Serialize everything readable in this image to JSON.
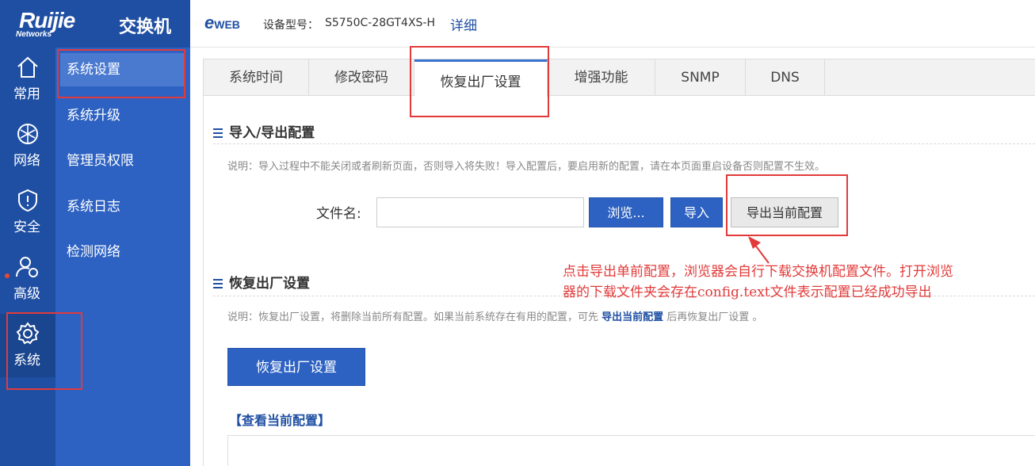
{
  "brand": {
    "logo": "Ruijie",
    "logo_sub": "Networks",
    "product": "交换机"
  },
  "topbar": {
    "eweb": "e",
    "eweb_rest": "WEB",
    "model_label": "设备型号：",
    "model": "S5750C-28GT4XS-H",
    "detail": "详细"
  },
  "nav": {
    "items": [
      {
        "label": "常用",
        "icon": "home-icon"
      },
      {
        "label": "网络",
        "icon": "network-globe-icon"
      },
      {
        "label": "安全",
        "icon": "shield-icon"
      },
      {
        "label": "高级",
        "icon": "user-settings-icon"
      },
      {
        "label": "系统",
        "icon": "gear-icon",
        "active": true
      }
    ]
  },
  "subnav": {
    "items": [
      {
        "label": "系统设置",
        "active": true
      },
      {
        "label": "系统升级"
      },
      {
        "label": "管理员权限"
      },
      {
        "label": "系统日志"
      },
      {
        "label": "检测网络"
      }
    ]
  },
  "tabs": [
    "系统时间",
    "修改密码",
    "恢复出厂设置",
    "增强功能",
    "SNMP",
    "DNS"
  ],
  "import_export": {
    "title": "导入/导出配置",
    "desc": "说明：导入过程中不能关闭或者刷新页面，否则导入将失败！导入配置后，要启用新的配置，请在本页面重启设备否则配置不生效。",
    "file_label": "文件名:",
    "file_value": "",
    "browse": "浏览...",
    "import": "导入",
    "export": "导出当前配置"
  },
  "factory": {
    "title": "恢复出厂设置",
    "desc_pre": "说明：恢复出厂设置，将删除当前所有配置。如果当前系统存在有用的配置，可先 ",
    "desc_link": "导出当前配置",
    "desc_post": " 后再恢复出厂设置 。",
    "button": "恢复出厂设置"
  },
  "view_config": {
    "title": "【查看当前配置】"
  },
  "annotation": {
    "line1": "点击导出单前配置，浏览器会自行下载交换机配置文件。打开浏览",
    "line2": "器的下载文件夹会存在config.text文件表示配置已经成功导出"
  },
  "colors": {
    "brand_blue": "#1f4fa3",
    "subnav_blue": "#2d62c2",
    "annotation_red": "#e23a3a"
  }
}
